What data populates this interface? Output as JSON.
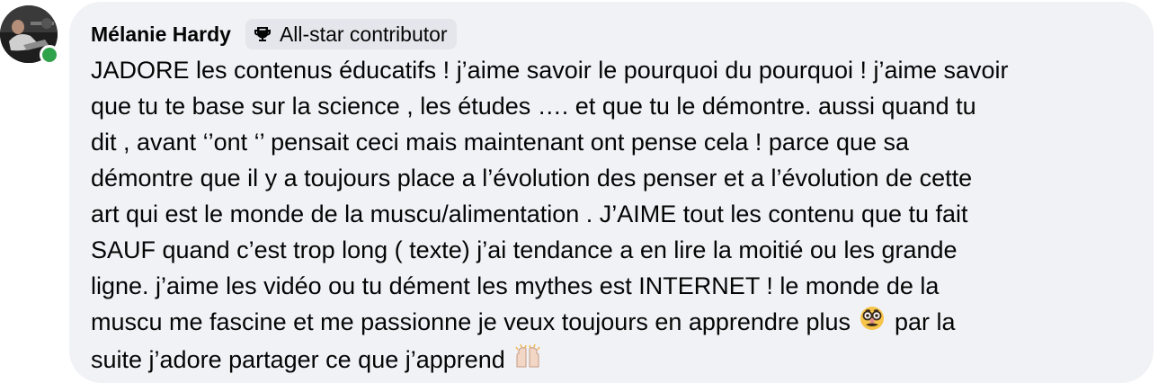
{
  "comment": {
    "author": "Mélanie Hardy",
    "badge": {
      "label": "All-star contributor",
      "icon": "trophy-icon"
    },
    "online": true,
    "text_part1": "JADORE les contenus éducatifs ! j’aime savoir le pourquoi du pourquoi ! j’aime savoir\nque tu te base sur la science , les études …. et que tu le démontre. aussi quand tu\ndit , avant ‘’ont ‘’ pensait ceci mais maintenant ont pense cela ! parce que sa\ndémontre que il y a toujours place a l’évolution des penser et a l’évolution de cette\nart qui est le monde de la muscu/alimentation . J’AIME tout les contenu que tu fait\nSAUF quand c’est trop long ( texte) j’ai tendance a en lire la moitié ou les grande\nligne. j’aime les vidéo ou tu dément les mythes est INTERNET ! le monde de la\nmuscu me fascine et me passionne je veux toujours en apprendre plus ",
    "emoji1": "disguised-face-emoji",
    "text_part2": " par la\nsuite j’adore partager ce que j’apprend ",
    "emoji2": "raising-hands-emoji",
    "colors": {
      "bubble": "#f0f2f5",
      "badge": "#e4e6eb",
      "online": "#31a24c",
      "text": "#050505"
    }
  }
}
